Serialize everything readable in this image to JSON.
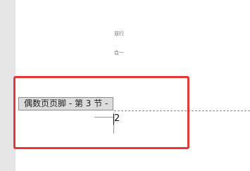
{
  "document": {
    "combine_text_lines": [
      "双行",
      "合一"
    ],
    "footer_tag_label": "偶数页页脚 - 第 3 节 -",
    "page_number": "2"
  },
  "annotation": {
    "highlight_color": "#e53935"
  },
  "colors": {
    "gutter": "#e6e6e6",
    "page": "#ffffff",
    "footer_tag_bg": "#dcdcdc"
  }
}
